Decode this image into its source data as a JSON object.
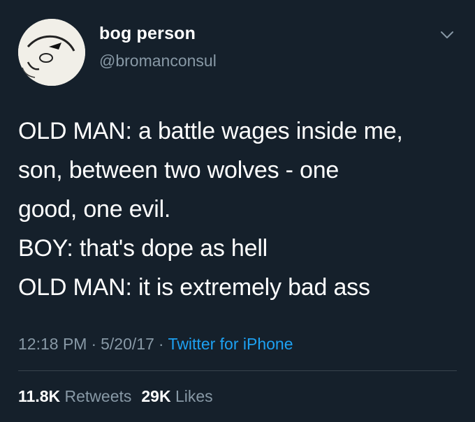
{
  "tweet": {
    "author": {
      "display_name": "bog person",
      "handle": "@bromanconsul",
      "avatar_icon": "wolf-avatar-icon"
    },
    "menu_icon": "chevron-down-icon",
    "text_lines": [
      "OLD MAN: a battle wages inside me,",
      "son, between two wolves - one",
      "good, one evil.",
      "BOY: that's dope as hell",
      "OLD MAN: it is extremely bad ass"
    ],
    "time": "12:18 PM",
    "date": "5/20/17",
    "separator": "·",
    "source": "Twitter for iPhone",
    "retweets_count": "11.8K",
    "retweets_label": "Retweets",
    "likes_count": "29K",
    "likes_label": "Likes"
  },
  "colors": {
    "background": "#15202b",
    "secondary_text": "#8899a6",
    "link": "#1da1f2",
    "divider": "#38444d"
  }
}
